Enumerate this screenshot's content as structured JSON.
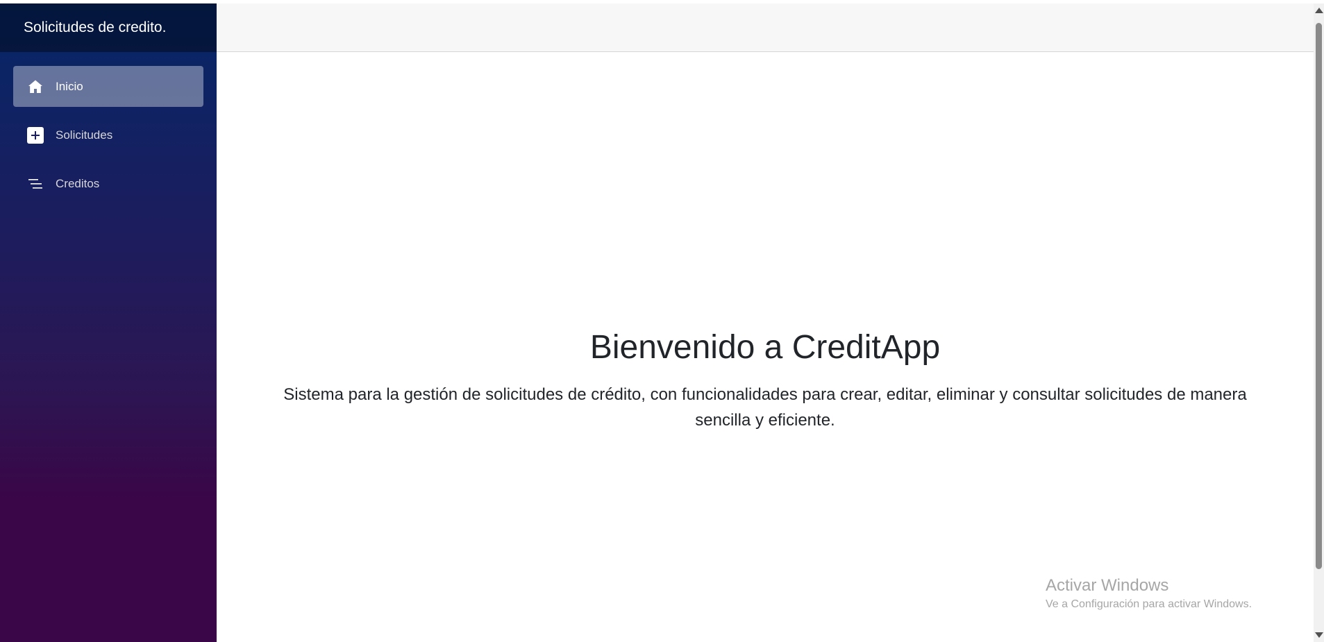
{
  "sidebar": {
    "brand": "Solicitudes de credito.",
    "items": [
      {
        "label": "Inicio",
        "icon": "home-icon",
        "active": true
      },
      {
        "label": "Solicitudes",
        "icon": "plus-icon",
        "active": false
      },
      {
        "label": "Creditos",
        "icon": "list-icon",
        "active": false
      }
    ]
  },
  "main": {
    "title": "Bienvenido a CreditApp",
    "description": "Sistema para la gestión de solicitudes de crédito, con funcionalidades para crear, editar, eliminar y consultar solicitudes de manera sencilla y eficiente."
  },
  "watermark": {
    "title": "Activar Windows",
    "subtitle": "Ve a Configuración para activar Windows."
  },
  "colors": {
    "sidebar_top": "#052767",
    "sidebar_bottom": "#3a0647",
    "topbar": "#f7f7f7",
    "text": "#212529"
  }
}
